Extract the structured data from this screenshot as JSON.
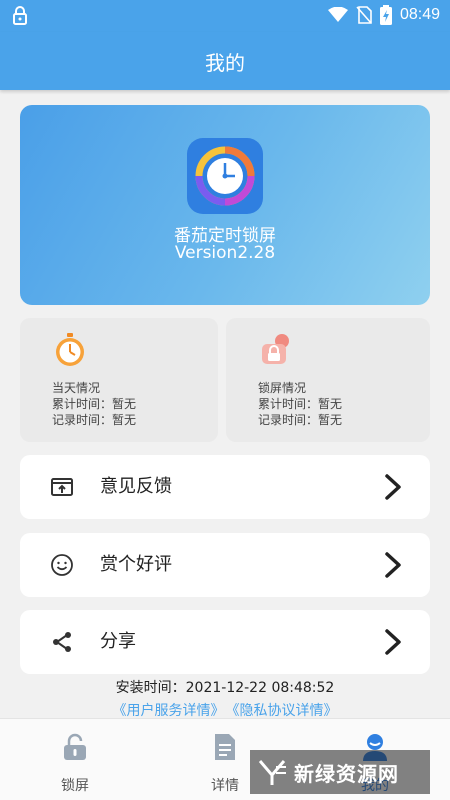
{
  "status_bar": {
    "time": "08:49"
  },
  "app_bar": {
    "title": "我的"
  },
  "app_info": {
    "name": "番茄定时锁屏",
    "version": "Version2.28"
  },
  "stats": [
    {
      "title": "当天情况",
      "line1": "累计时间：暂无",
      "line2": "记录时间：暂无",
      "icon": "stopwatch-icon"
    },
    {
      "title": "锁屏情况",
      "line1": "累计时间：暂无",
      "line2": "记录时间：暂无",
      "icon": "lock-screen-icon"
    }
  ],
  "menu": [
    {
      "label": "意见反馈",
      "icon": "feedback-icon"
    },
    {
      "label": "赏个好评",
      "icon": "smile-icon"
    },
    {
      "label": "分享",
      "icon": "share-icon"
    }
  ],
  "install": {
    "text": "安装时间：2021-12-22 08:48:52"
  },
  "links": {
    "user_service": "《用户服务详情》",
    "privacy": "《隐私协议详情》"
  },
  "tabs": [
    {
      "label": "锁屏",
      "icon": "lock-icon"
    },
    {
      "label": "详情",
      "icon": "document-icon"
    },
    {
      "label": "我的",
      "icon": "person-icon"
    }
  ],
  "watermark": {
    "text": "新绿资源网"
  },
  "colors": {
    "primary": "#4aa3ea",
    "accent": "#2f7fe0",
    "background": "#f1f1f1"
  }
}
